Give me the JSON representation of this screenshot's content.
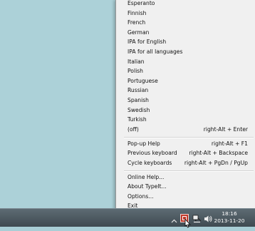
{
  "menu": {
    "languages": [
      "Esperanto",
      "Finnish",
      "French",
      "German",
      "IPA for English",
      "IPA for all languages",
      "Italian",
      "Polish",
      "Portuguese",
      "Russian",
      "Spanish",
      "Swedish",
      "Turkish"
    ],
    "off": {
      "label": "(off)",
      "shortcut": "right-Alt + Enter"
    },
    "actions": [
      {
        "label": "Pop-up Help",
        "shortcut": "right-Alt + F1"
      },
      {
        "label": "Previous keyboard",
        "shortcut": "right-Alt + Backspace"
      },
      {
        "label": "Cycle keyboards",
        "shortcut": "right-Alt + PgDn / PgUp"
      }
    ],
    "misc": [
      "Online Help...",
      "About TypeIt...",
      "Options...",
      "Exit"
    ]
  },
  "taskbar": {
    "time": "18:16",
    "date": "2013-11-20",
    "tray_icons": [
      "show-hidden-icons-chevron",
      "typeit-icon",
      "network-icon",
      "volume-icon"
    ]
  },
  "colors": {
    "desktop": "#acd1d8",
    "menu_bg": "#f0f0f0",
    "taskbar": "#4a555c",
    "accent": "#c0392b"
  }
}
